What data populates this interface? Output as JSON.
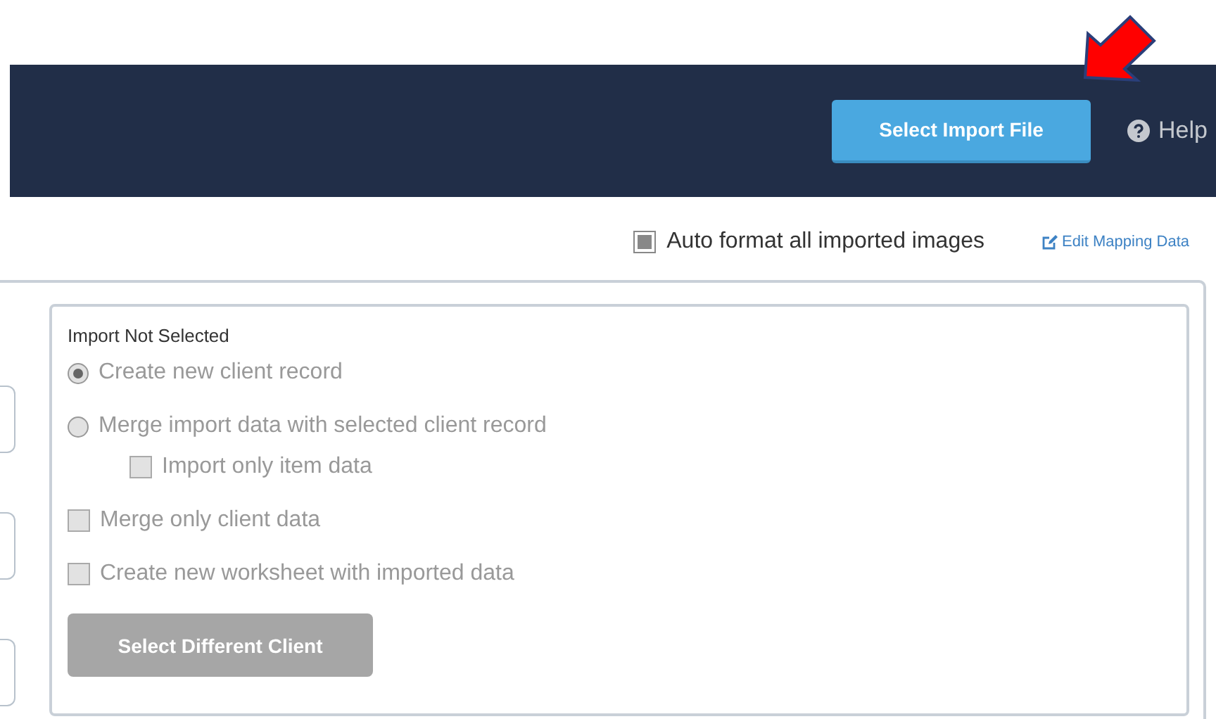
{
  "header": {
    "import_button": "Select Import File",
    "help": "Help"
  },
  "toolbar": {
    "auto_format": {
      "label": "Auto format all imported images",
      "checked": true
    },
    "edit_link": "Edit Mapping Data"
  },
  "import_panel": {
    "title": "Import Not Selected",
    "options": [
      {
        "kind": "radio",
        "label": "Create new client record",
        "selected": true,
        "disabled": true
      },
      {
        "kind": "radio",
        "label": "Merge import data with selected client record",
        "selected": false,
        "disabled": true,
        "children": [
          {
            "kind": "checkbox",
            "label": "Import only item data",
            "checked": false,
            "disabled": true
          }
        ]
      },
      {
        "kind": "checkbox",
        "label": "Merge only client data",
        "checked": false,
        "disabled": true
      },
      {
        "kind": "checkbox",
        "label": "Create new worksheet with imported data",
        "checked": false,
        "disabled": true
      }
    ],
    "button": {
      "label": "Select Different Client",
      "disabled": true
    }
  }
}
